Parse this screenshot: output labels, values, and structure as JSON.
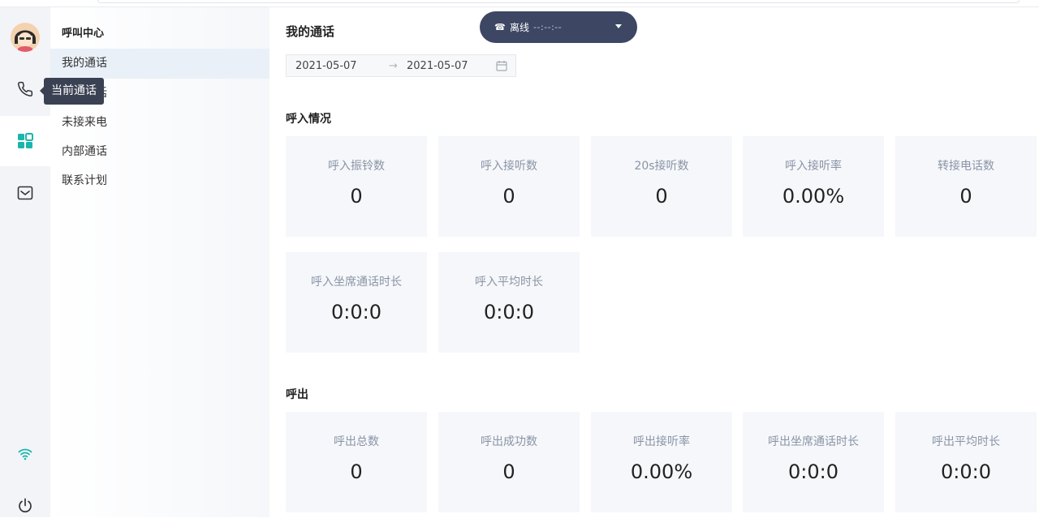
{
  "rail": {
    "tooltip": "当前通话",
    "accent_color": "#1ab5ad",
    "icons": [
      "avatar",
      "phone-icon",
      "apps-icon",
      "mail-icon",
      "wifi-icon",
      "power-icon"
    ]
  },
  "subnav": {
    "title": "呼叫中心",
    "items": [
      {
        "label": "我的通话"
      },
      {
        "label": "当前通话"
      },
      {
        "label": "未接来电"
      },
      {
        "label": "内部通话"
      },
      {
        "label": "联系计划"
      }
    ]
  },
  "main": {
    "title": "我的通话",
    "date_start": "2021-05-07",
    "date_sep": "→",
    "date_end": "2021-05-07",
    "status": {
      "phone_glyph": "☎",
      "label": "离线",
      "time": "--:--:--"
    },
    "inbound": {
      "title": "呼入情况",
      "cards": [
        {
          "label": "呼入振铃数",
          "value": "0"
        },
        {
          "label": "呼入接听数",
          "value": "0"
        },
        {
          "label": "20s接听数",
          "value": "0"
        },
        {
          "label": "呼入接听率",
          "value": "0.00%"
        },
        {
          "label": "转接电话数",
          "value": "0"
        },
        {
          "label": "呼入坐席通话时长",
          "value": "0:0:0"
        },
        {
          "label": "呼入平均时长",
          "value": "0:0:0"
        }
      ]
    },
    "outbound": {
      "title": "呼出",
      "cards": [
        {
          "label": "呼出总数",
          "value": "0"
        },
        {
          "label": "呼出成功数",
          "value": "0"
        },
        {
          "label": "呼出接听率",
          "value": "0.00%"
        },
        {
          "label": "呼出坐席通话时长",
          "value": "0:0:0"
        },
        {
          "label": "呼出平均时长",
          "value": "0:0:0"
        }
      ]
    }
  }
}
